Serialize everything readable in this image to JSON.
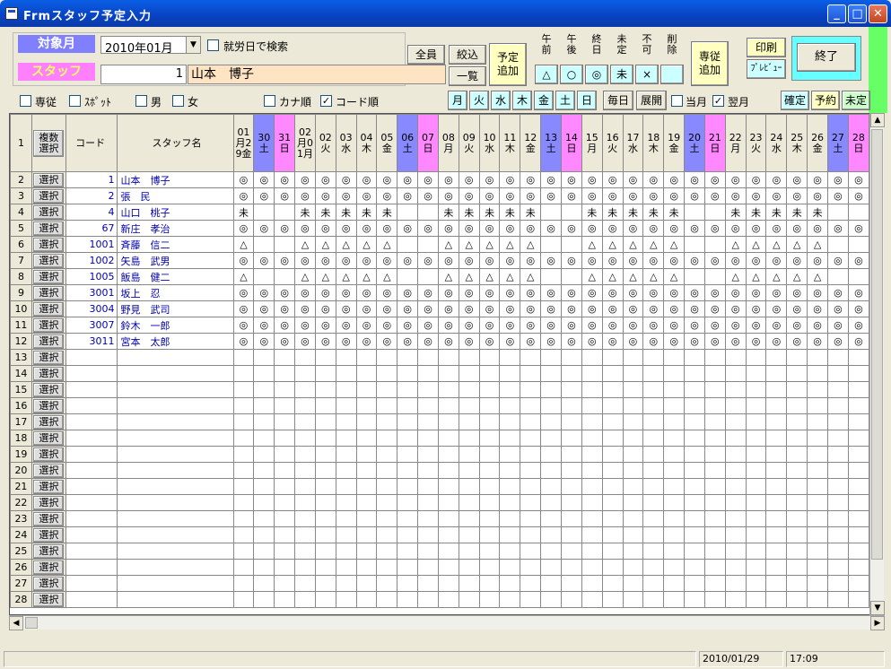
{
  "window": {
    "title": "Frmスタッフ予定入力"
  },
  "form": {
    "target_month_label": "対象月",
    "target_month_value": "2010年01月",
    "workday_search_label": "就労日で検索",
    "staff_label": "スタッフ",
    "staff_number": "1",
    "staff_name": "山本　博子",
    "all_label": "全員",
    "filter_label": "絞込",
    "list_label": "一覧",
    "add_schedule_label": "予定追加",
    "exclusive_label": "専従",
    "spot_label": "ｽﾎﾟｯﾄ",
    "male_label": "男",
    "female_label": "女",
    "kana_order_label": "カナ順",
    "code_order_label": "コード順",
    "code_order_checked": true,
    "symbols": [
      {
        "head": "午前",
        "mark": "△"
      },
      {
        "head": "午後",
        "mark": "○"
      },
      {
        "head": "終日",
        "mark": "◎"
      },
      {
        "head": "未定",
        "mark": "未"
      },
      {
        "head": "不可",
        "mark": "×"
      },
      {
        "head": "削除",
        "mark": ""
      }
    ],
    "exclusive_add_label": "専従追加",
    "print_label": "印刷",
    "preview_label": "ﾌﾟﾚﾋﾞｭｰ",
    "exit_label": "終了",
    "weekdays": [
      "月",
      "火",
      "水",
      "木",
      "金",
      "土",
      "日"
    ],
    "every_day_label": "毎日",
    "expand_label": "展開",
    "this_month_label": "当月",
    "next_month_label": "翌月",
    "next_month_checked": true,
    "confirm_label": "確定",
    "reserve_label": "予約",
    "undecided_label": "未定",
    "colors": {
      "target": "#8080ff",
      "staff": "#ff80ff",
      "staffname_bg": "#ffe4c4",
      "sat": "#8888ff",
      "sun": "#ff88ff"
    }
  },
  "grid": {
    "header_row_number": "1",
    "multi_select_label": "複数選択",
    "code_header": "コード",
    "name_header": "スタッフ名",
    "select_label": "選択",
    "days": [
      {
        "label": "01月29金",
        "type": "wd"
      },
      {
        "label": "30土",
        "type": "sat"
      },
      {
        "label": "31日",
        "type": "sun"
      },
      {
        "label": "02月01月",
        "type": "wd"
      },
      {
        "label": "02火",
        "type": "wd"
      },
      {
        "label": "03水",
        "type": "wd"
      },
      {
        "label": "04木",
        "type": "wd"
      },
      {
        "label": "05金",
        "type": "wd"
      },
      {
        "label": "06土",
        "type": "sat"
      },
      {
        "label": "07日",
        "type": "sun"
      },
      {
        "label": "08月",
        "type": "wd"
      },
      {
        "label": "09火",
        "type": "wd"
      },
      {
        "label": "10水",
        "type": "wd"
      },
      {
        "label": "11木",
        "type": "wd"
      },
      {
        "label": "12金",
        "type": "wd"
      },
      {
        "label": "13土",
        "type": "sat"
      },
      {
        "label": "14日",
        "type": "sun"
      },
      {
        "label": "15月",
        "type": "wd"
      },
      {
        "label": "16火",
        "type": "wd"
      },
      {
        "label": "17水",
        "type": "wd"
      },
      {
        "label": "18木",
        "type": "wd"
      },
      {
        "label": "19金",
        "type": "wd"
      },
      {
        "label": "20土",
        "type": "sat"
      },
      {
        "label": "21日",
        "type": "sun"
      },
      {
        "label": "22月",
        "type": "wd"
      },
      {
        "label": "23火",
        "type": "wd"
      },
      {
        "label": "24水",
        "type": "wd"
      },
      {
        "label": "25木",
        "type": "wd"
      },
      {
        "label": "26金",
        "type": "wd"
      },
      {
        "label": "27土",
        "type": "sat"
      },
      {
        "label": "28日",
        "type": "sun"
      }
    ],
    "rows": [
      {
        "n": "2",
        "code": "1",
        "name": "山本　博子",
        "marks": "◎◎◎◎◎◎◎◎◎◎◎◎◎◎◎◎◎◎◎◎◎◎◎◎◎◎◎◎◎◎◎"
      },
      {
        "n": "3",
        "code": "2",
        "name": "張　民",
        "marks": "◎◎◎◎◎◎◎◎◎◎◎◎◎◎◎◎◎◎◎◎◎◎◎◎◎◎◎◎◎◎◎"
      },
      {
        "n": "4",
        "code": "4",
        "name": "山口　桃子",
        "marks": "未  未未未未未  未未未未未  未未未未未  未未未未未  "
      },
      {
        "n": "5",
        "code": "67",
        "name": "新庄　孝治",
        "marks": "◎◎◎◎◎◎◎◎◎◎◎◎◎◎◎◎◎◎◎◎◎◎◎◎◎◎◎◎◎◎◎"
      },
      {
        "n": "6",
        "code": "1001",
        "name": "斉藤　信二",
        "marks": "△  △△△△△  △△△△△  △△△△△  △△△△△  "
      },
      {
        "n": "7",
        "code": "1002",
        "name": "矢島　武男",
        "marks": "◎◎◎◎◎◎◎◎◎◎◎◎◎◎◎◎◎◎◎◎◎◎◎◎◎◎◎◎◎◎◎"
      },
      {
        "n": "8",
        "code": "1005",
        "name": "飯島　健二",
        "marks": "△  △△△△△  △△△△△  △△△△△  △△△△△  "
      },
      {
        "n": "9",
        "code": "3001",
        "name": "坂上　忍",
        "marks": "◎◎◎◎◎◎◎◎◎◎◎◎◎◎◎◎◎◎◎◎◎◎◎◎◎◎◎◎◎◎◎"
      },
      {
        "n": "10",
        "code": "3004",
        "name": "野見　武司",
        "marks": "◎◎◎◎◎◎◎◎◎◎◎◎◎◎◎◎◎◎◎◎◎◎◎◎◎◎◎◎◎◎◎"
      },
      {
        "n": "11",
        "code": "3007",
        "name": "鈴木　一郎",
        "marks": "◎◎◎◎◎◎◎◎◎◎◎◎◎◎◎◎◎◎◎◎◎◎◎◎◎◎◎◎◎◎◎"
      },
      {
        "n": "12",
        "code": "3011",
        "name": "宮本　太郎",
        "marks": "◎◎◎◎◎◎◎◎◎◎◎◎◎◎◎◎◎◎◎◎◎◎◎◎◎◎◎◎◎◎◎"
      },
      {
        "n": "13",
        "code": "",
        "name": "",
        "marks": ""
      },
      {
        "n": "14",
        "code": "",
        "name": "",
        "marks": ""
      },
      {
        "n": "15",
        "code": "",
        "name": "",
        "marks": ""
      },
      {
        "n": "16",
        "code": "",
        "name": "",
        "marks": ""
      },
      {
        "n": "17",
        "code": "",
        "name": "",
        "marks": ""
      },
      {
        "n": "18",
        "code": "",
        "name": "",
        "marks": ""
      },
      {
        "n": "19",
        "code": "",
        "name": "",
        "marks": ""
      },
      {
        "n": "20",
        "code": "",
        "name": "",
        "marks": ""
      },
      {
        "n": "21",
        "code": "",
        "name": "",
        "marks": ""
      },
      {
        "n": "22",
        "code": "",
        "name": "",
        "marks": ""
      },
      {
        "n": "23",
        "code": "",
        "name": "",
        "marks": ""
      },
      {
        "n": "24",
        "code": "",
        "name": "",
        "marks": ""
      },
      {
        "n": "25",
        "code": "",
        "name": "",
        "marks": ""
      },
      {
        "n": "26",
        "code": "",
        "name": "",
        "marks": ""
      },
      {
        "n": "27",
        "code": "",
        "name": "",
        "marks": ""
      },
      {
        "n": "28",
        "code": "",
        "name": "",
        "marks": ""
      }
    ]
  },
  "status": {
    "date": "2010/01/29",
    "time": "17:09"
  }
}
